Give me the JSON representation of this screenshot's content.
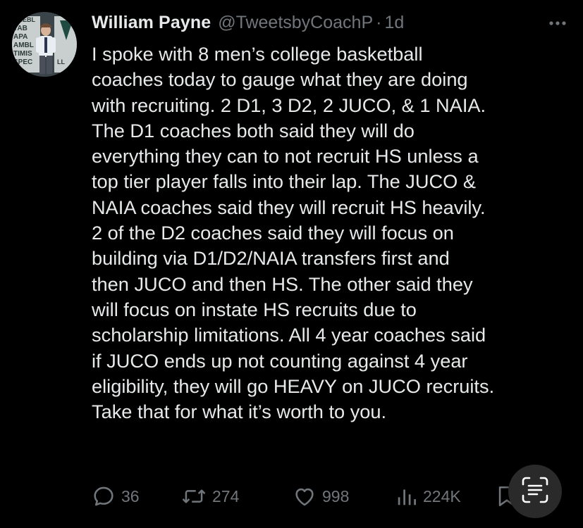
{
  "author": {
    "name": "William Payne",
    "handle": "@TweetsbyCoachP",
    "separator": "·",
    "time": "1d"
  },
  "avatar": {
    "sign_text": [
      "UNEBL",
      "TAB",
      "APA",
      "AMBL",
      "TIMIS",
      "SPEC",
      "LL"
    ]
  },
  "tweet": {
    "lines": [
      "I spoke with 8 men’s college basketball",
      "coaches today to gauge what they are doing",
      "with recruiting. 2 D1, 3 D2, 2 JUCO, & 1 NAIA.",
      "The D1 coaches both said they will do",
      "everything they can to not recruit HS unless a",
      "top tier player falls into their lap. The JUCO &",
      "NAIA coaches said they will recruit HS heavily.",
      "2 of the D2 coaches said they will focus on",
      "building via D1/D2/NAIA transfers first and",
      "then JUCO and then HS. The other said they",
      "will focus on instate HS recruits due to",
      "scholarship limitations. All 4 year coaches said",
      "if JUCO ends up not counting against 4 year",
      "eligibility, they will go HEAVY on JUCO recruits.",
      "Take that for what it’s worth to you."
    ]
  },
  "actions": {
    "replies": "36",
    "retweets": "274",
    "likes": "998",
    "views": "224K"
  },
  "icons": {
    "more": "more-horizontal-icon",
    "reply": "reply-icon",
    "retweet": "retweet-icon",
    "like": "heart-icon",
    "views": "views-bar-chart-icon",
    "bookmark": "bookmark-icon",
    "scan": "scan-text-icon"
  },
  "colors": {
    "background": "#000000",
    "text_primary": "#e7e9ea",
    "text_secondary": "#71767b",
    "scan_button": "#2a2a2a"
  }
}
